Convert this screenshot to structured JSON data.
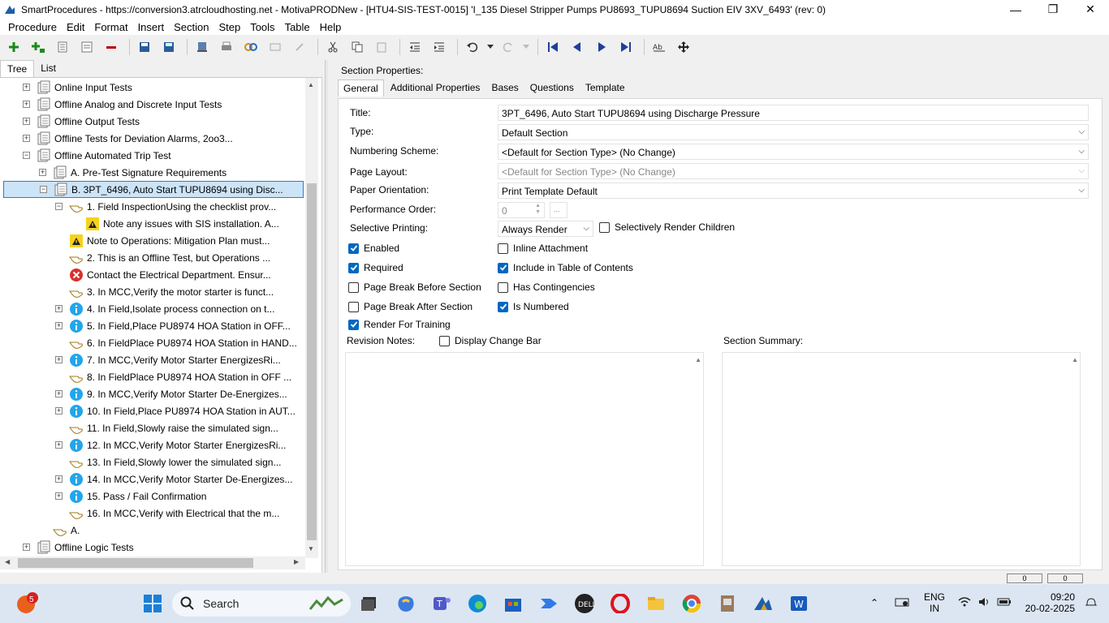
{
  "window": {
    "title": "SmartProcedures - https://conversion3.atrcloudhosting.net - MotivaPRODNew - [HTU4-SIS-TEST-0015] 'I_135 Diesel Stripper Pumps PU8693_TUPU8694 Suction EIV 3XV_6493' (rev: 0)",
    "minimize": "—",
    "restore": "❐",
    "close": "✕"
  },
  "menu": [
    "Procedure",
    "Edit",
    "Format",
    "Insert",
    "Section",
    "Step",
    "Tools",
    "Table",
    "Help"
  ],
  "left_tabs": [
    "Tree",
    "List"
  ],
  "tree": [
    {
      "label": "Online Input Tests",
      "level": 0,
      "expander": "+",
      "icon": "document-icon"
    },
    {
      "label": "Offline Analog and Discrete Input Tests",
      "level": 0,
      "expander": "+",
      "icon": "document-icon"
    },
    {
      "label": "Offline Output Tests",
      "level": 0,
      "expander": "+",
      "icon": "document-icon"
    },
    {
      "label": "Offline Tests for Deviation Alarms, 2oo3...",
      "level": 0,
      "expander": "+",
      "icon": "document-icon"
    },
    {
      "label": "Offline Automated Trip Test",
      "level": 0,
      "expander": "−",
      "icon": "document-icon"
    },
    {
      "label": "A. Pre-Test Signature Requirements",
      "level": 1,
      "expander": "+",
      "icon": "document-icon"
    },
    {
      "label": "B. 3PT_6496, Auto Start TUPU8694 using Disc...",
      "level": 1,
      "expander": "−",
      "icon": "document-icon",
      "selected": true
    },
    {
      "label": "1. Field InspectionUsing the checklist prov...",
      "level": 2,
      "expander": "−",
      "icon": "hand-icon"
    },
    {
      "label": "Note any issues with SIS installation. A...",
      "level": 3,
      "expander": "",
      "icon": "note-icon"
    },
    {
      "label": "Note to Operations: Mitigation Plan must...",
      "level": 2,
      "expander": "",
      "icon": "note-icon"
    },
    {
      "label": "2. This is an Offline Test, but Operations ...",
      "level": 2,
      "expander": "",
      "icon": "hand-icon"
    },
    {
      "label": "Contact the Electrical Department. Ensur...",
      "level": 2,
      "expander": "",
      "icon": "error-icon"
    },
    {
      "label": "3. In MCC,Verify the motor starter is funct...",
      "level": 2,
      "expander": "",
      "icon": "hand-icon"
    },
    {
      "label": "4. In Field,Isolate process connection on t...",
      "level": 2,
      "expander": "+",
      "icon": "info-icon"
    },
    {
      "label": "5. In Field,Place PU8974 HOA Station in OFF...",
      "level": 2,
      "expander": "+",
      "icon": "info-icon"
    },
    {
      "label": "6. In FieldPlace PU8974 HOA Station in HAND...",
      "level": 2,
      "expander": "",
      "icon": "hand-icon"
    },
    {
      "label": "7. In MCC,Verify Motor Starter EnergizesRi...",
      "level": 2,
      "expander": "+",
      "icon": "info-icon"
    },
    {
      "label": "8. In FieldPlace PU8974 HOA Station in OFF ...",
      "level": 2,
      "expander": "",
      "icon": "hand-icon"
    },
    {
      "label": "9. In MCC,Verify Motor Starter De-Energizes...",
      "level": 2,
      "expander": "+",
      "icon": "info-icon"
    },
    {
      "label": "10. In Field,Place PU8974 HOA Station in AUT...",
      "level": 2,
      "expander": "+",
      "icon": "info-icon"
    },
    {
      "label": "11. In Field,Slowly raise the simulated sign...",
      "level": 2,
      "expander": "",
      "icon": "hand-icon"
    },
    {
      "label": "12. In MCC,Verify Motor Starter EnergizesRi...",
      "level": 2,
      "expander": "+",
      "icon": "info-icon"
    },
    {
      "label": "13. In Field,Slowly lower the simulated sign...",
      "level": 2,
      "expander": "",
      "icon": "hand-icon"
    },
    {
      "label": "14. In MCC,Verify Motor Starter De-Energizes...",
      "level": 2,
      "expander": "+",
      "icon": "info-icon"
    },
    {
      "label": "15. Pass / Fail Confirmation",
      "level": 2,
      "expander": "+",
      "icon": "info-icon"
    },
    {
      "label": "16. In MCC,Verify with Electrical that the m...",
      "level": 2,
      "expander": "",
      "icon": "hand-icon"
    },
    {
      "label": "A.",
      "level": 1,
      "expander": "",
      "icon": "hand-icon"
    },
    {
      "label": "Offline Logic Tests",
      "level": 0,
      "expander": "+",
      "icon": "document-icon"
    }
  ],
  "right": {
    "section_props_label": "Section Properties:",
    "tabs": [
      "General",
      "Additional Properties",
      "Bases",
      "Questions",
      "Template"
    ],
    "title_label": "Title:",
    "title_value": "3PT_6496, Auto Start TUPU8694 using Discharge Pressure",
    "type_label": "Type:",
    "type_value": "Default Section",
    "numbering_label": "Numbering Scheme:",
    "numbering_value": "<Default for Section Type> (No Change)",
    "layout_label": "Page Layout:",
    "layout_value": "<Default for Section Type> (No Change)",
    "orientation_label": "Paper Orientation:",
    "orientation_value": "Print Template Default",
    "perf_label": "Performance Order:",
    "perf_value": "0",
    "selective_label": "Selective Printing:",
    "selective_value": "Always Render",
    "selectively_render_children": "Selectively Render Children",
    "enabled": "Enabled",
    "inline_attachment": "Inline Attachment",
    "required": "Required",
    "include_toc": "Include in Table of Contents",
    "page_break_before": "Page Break Before Section",
    "has_contingencies": "Has Contingencies",
    "page_break_after": "Page Break After Section",
    "is_numbered": "Is Numbered",
    "render_training": "Render For Training",
    "revision_notes_label": "Revision Notes:",
    "display_change_bar": "Display Change Bar",
    "section_summary_label": "Section Summary:"
  },
  "status": {
    "pane1": "0",
    "pane2": "0"
  },
  "taskbar": {
    "search_label": "Search",
    "notification_count": "5",
    "lang1": "ENG",
    "lang2": "IN",
    "time": "09:20",
    "date": "20-02-2025"
  }
}
